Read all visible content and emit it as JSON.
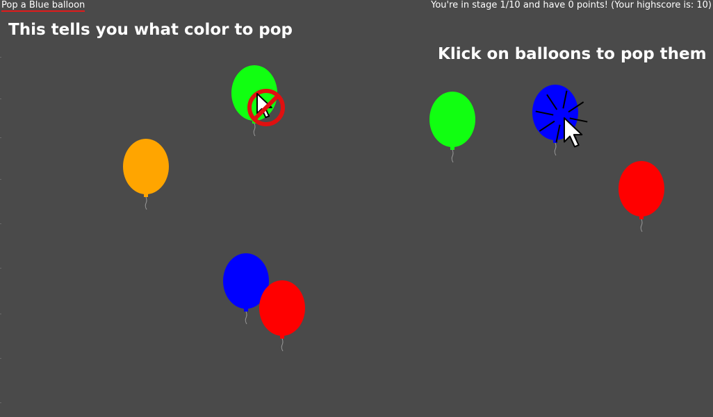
{
  "header": {
    "instruction": "Pop a Blue balloon",
    "status": "You're in stage 1/10 and have 0 points! (Your highscore is: 10)"
  },
  "hints": {
    "color_hint": "This tells you what color to pop",
    "click_hint": "Klick on balloons to pop them"
  },
  "game": {
    "target_color": "blue",
    "stage": 1,
    "total_stages": 10,
    "points": 0,
    "highscore": 10
  },
  "colors": {
    "background": "#4a4a4a",
    "underline": "#e11b1b",
    "green": "#11ff11",
    "orange": "#ffa500",
    "blue": "#0000ff",
    "red": "#ff0000"
  },
  "balloons": [
    {
      "color": "green"
    },
    {
      "color": "orange"
    },
    {
      "color": "green"
    },
    {
      "color": "blue"
    },
    {
      "color": "red"
    },
    {
      "color": "blue"
    },
    {
      "color": "red"
    }
  ],
  "icons": {
    "wrong_click": "no-cursor-icon",
    "correct_click": "pop-cursor-icon"
  }
}
